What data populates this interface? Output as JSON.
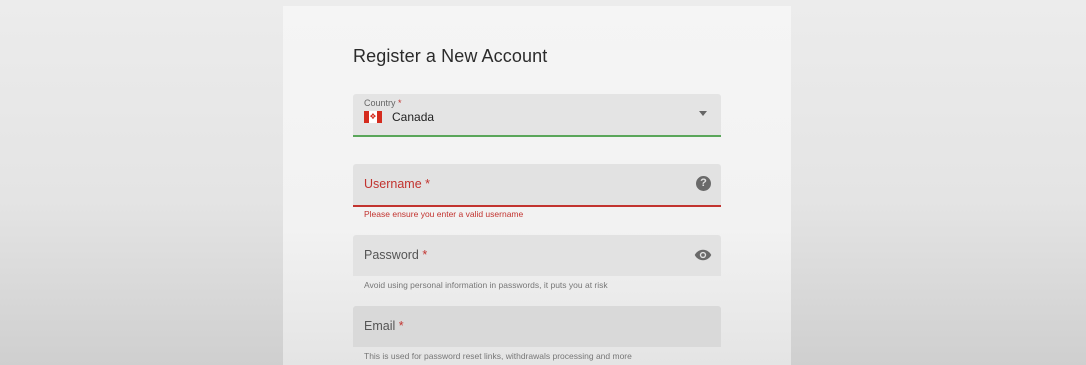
{
  "form": {
    "title": "Register a New Account",
    "country": {
      "label": "Country",
      "required_mark": "*",
      "value": "Canada",
      "flag_icon": "canada-flag-icon"
    },
    "username": {
      "label": "Username",
      "required_mark": "*",
      "error": "Please ensure you enter a valid username",
      "icon": "help-icon"
    },
    "password": {
      "label": "Password",
      "required_mark": "*",
      "hint": "Avoid using personal information in passwords, it puts you at risk",
      "icon": "eye-icon"
    },
    "email": {
      "label": "Email",
      "required_mark": "*",
      "hint": "This is used for password reset links, withdrawals processing and more"
    }
  },
  "colors": {
    "error": "#c2332f",
    "success": "#5aa65a"
  }
}
